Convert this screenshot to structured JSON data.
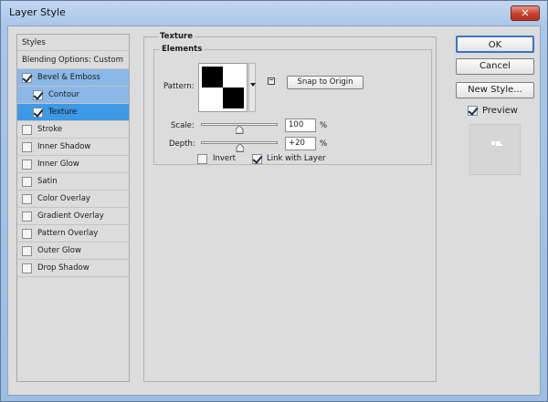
{
  "window": {
    "title": "Layer Style",
    "close_glyph": "✕"
  },
  "styles_panel": {
    "header": "Styles",
    "blending": "Blending Options: Custom",
    "items": [
      {
        "label": "Bevel & Emboss",
        "checked": true
      },
      {
        "label": "Contour",
        "checked": true
      },
      {
        "label": "Texture",
        "checked": true
      },
      {
        "label": "Stroke",
        "checked": false
      },
      {
        "label": "Inner Shadow",
        "checked": false
      },
      {
        "label": "Inner Glow",
        "checked": false
      },
      {
        "label": "Satin",
        "checked": false
      },
      {
        "label": "Color Overlay",
        "checked": false
      },
      {
        "label": "Gradient Overlay",
        "checked": false
      },
      {
        "label": "Pattern Overlay",
        "checked": false
      },
      {
        "label": "Outer Glow",
        "checked": false
      },
      {
        "label": "Drop Shadow",
        "checked": false
      }
    ]
  },
  "texture": {
    "group_title": "Texture",
    "elements_title": "Elements",
    "pattern_label": "Pattern:",
    "snap_button": "Snap to Origin",
    "scale_label": "Scale:",
    "scale_value": "100",
    "scale_level_pct": 100,
    "scale_unit": "%",
    "depth_label": "Depth:",
    "depth_value": "+20",
    "depth_level": 20,
    "depth_unit": "%",
    "invert_label": "Invert",
    "invert_checked": false,
    "link_label": "Link with Layer",
    "link_checked": true
  },
  "actions": {
    "ok": "OK",
    "cancel": "Cancel",
    "new_style": "New Style...",
    "preview_label": "Preview",
    "preview_checked": true
  },
  "icons": {
    "pattern_dropdown": "chevron-down-icon",
    "new_preset": "new-preset-icon",
    "close": "close-icon"
  },
  "colors": {
    "selection_light": "#8ab8e8",
    "selection_active": "#3d98e6",
    "close_button": "#c7402a",
    "panel_bg": "#dcdcdc"
  }
}
